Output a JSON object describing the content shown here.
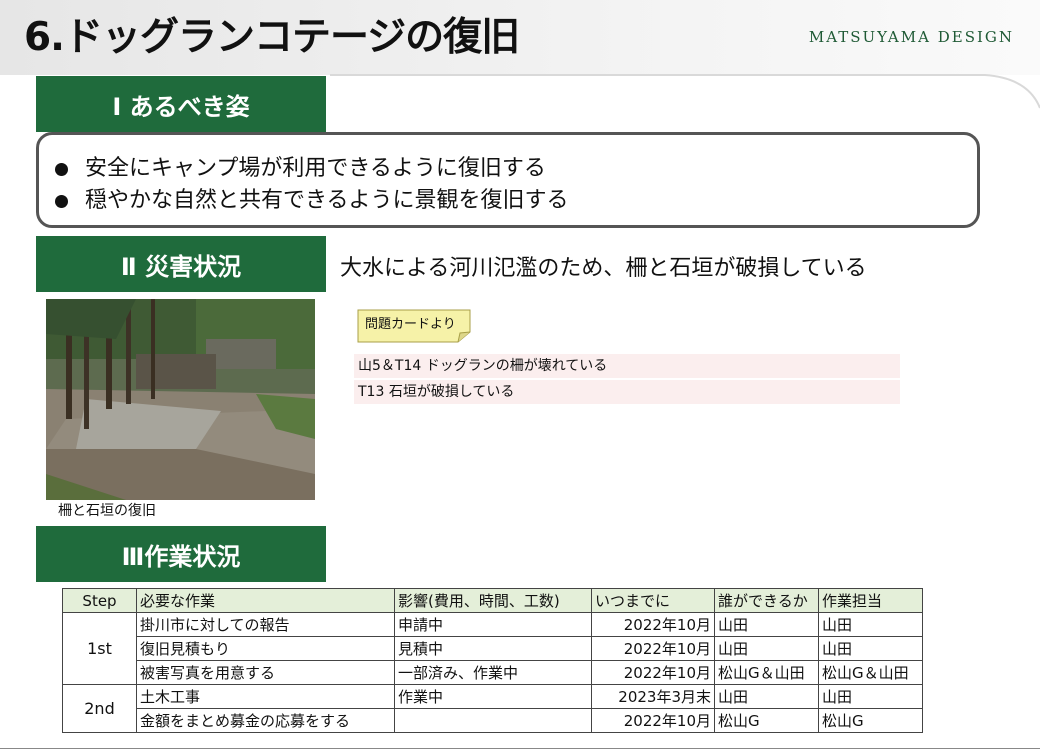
{
  "header": {
    "title": "6.ドッグランコテージの復旧",
    "brand": "MATSUYAMA DESIGN"
  },
  "section1": {
    "heading": "Ⅰ あるべき姿",
    "goals": [
      "安全にキャンプ場が利用できるように復旧する",
      "穏やかな自然と共有できるように景観を復旧する"
    ]
  },
  "section2": {
    "heading": "Ⅱ 災害状況",
    "description": "大水による河川氾濫のため、柵と石垣が破損している",
    "photo_caption": "柵と石垣の復旧",
    "card_label": "問題カードより",
    "problems": [
      "山5＆T14 ドッグランの柵が壊れている",
      "T13 石垣が破損している"
    ]
  },
  "section3": {
    "heading": "Ⅲ作業状況",
    "columns": [
      "Step",
      "必要な作業",
      "影響(費用、時間、工数)",
      "いつまでに",
      "誰ができるか",
      "作業担当"
    ],
    "groups": [
      {
        "step": "1st",
        "rows": [
          [
            "掛川市に対しての報告",
            "申請中",
            "2022年10月",
            "山田",
            "山田"
          ],
          [
            "復旧見積もり",
            "見積中",
            "2022年10月",
            "山田",
            "山田"
          ],
          [
            "被害写真を用意する",
            "一部済み、作業中",
            "2022年10月",
            "松山G＆山田",
            "松山G＆山田"
          ]
        ]
      },
      {
        "step": "2nd",
        "rows": [
          [
            "土木工事",
            "作業中",
            "2023年3月末",
            "山田",
            "山田"
          ],
          [
            "金額をまとめ募金の応募をする",
            "",
            "2022年10月",
            "松山G",
            "松山G"
          ]
        ]
      }
    ]
  },
  "colors": {
    "section_green": "#1f6b3c",
    "header_cell": "#e4efd9",
    "problem_row": "#fbeeee",
    "card_note": "#f6f2a8"
  },
  "icons": [
    "bullet-dot-icon"
  ]
}
